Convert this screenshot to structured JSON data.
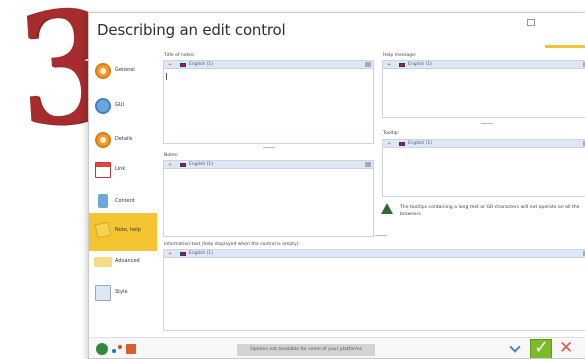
{
  "step": {
    "numeral": "3"
  },
  "window": {
    "title": "Describing an edit control"
  },
  "sidebar": {
    "items": [
      {
        "label": "General",
        "icon": "general-icon"
      },
      {
        "label": "GUI",
        "icon": "gui-icon"
      },
      {
        "label": "Details",
        "icon": "details-icon"
      },
      {
        "label": "Link",
        "icon": "link-icon"
      },
      {
        "label": "Content",
        "icon": "content-icon"
      },
      {
        "label": "Note, help",
        "icon": "note-help-icon",
        "active": true
      },
      {
        "label": "Advanced",
        "icon": "advanced-icon"
      },
      {
        "label": "Style",
        "icon": "style-icon"
      }
    ]
  },
  "fields": {
    "title_of_notes": {
      "label": "Title of notes:",
      "language": "English (1)"
    },
    "notes": {
      "label": "Notes:",
      "language": "English (1)"
    },
    "help_message": {
      "label": "Help message:",
      "language": "English (1)"
    },
    "tooltip": {
      "label": "Tooltip:",
      "language": "English (1)"
    },
    "information_text": {
      "label": "Information text (help displayed when the control is empty):",
      "language": "English (1)"
    }
  },
  "tooltip_warning": "The tooltips containing a long text or GR characters will not operate on all the browsers.",
  "bottom_bar": {
    "platform_note": "Options not available for some of your platforms"
  },
  "colors": {
    "accent": "#f4c531",
    "step_red": "#a62c2e",
    "ok_green": "#7cbc2b",
    "cancel_red": "#e05a4a"
  }
}
